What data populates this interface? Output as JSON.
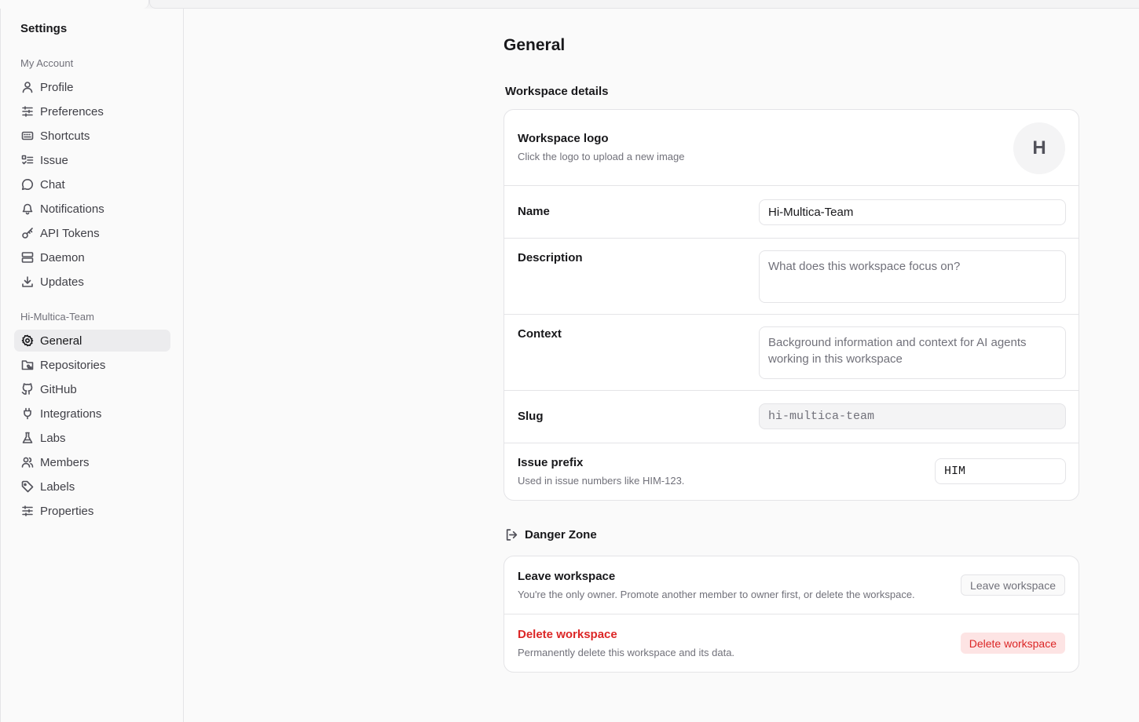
{
  "sidebar": {
    "title": "Settings",
    "account_section": "My Account",
    "account_items": [
      {
        "label": "Profile",
        "icon": "user-icon"
      },
      {
        "label": "Preferences",
        "icon": "sliders-icon"
      },
      {
        "label": "Shortcuts",
        "icon": "keyboard-icon"
      },
      {
        "label": "Issue",
        "icon": "list-check-icon"
      },
      {
        "label": "Chat",
        "icon": "chat-icon"
      },
      {
        "label": "Notifications",
        "icon": "bell-icon"
      },
      {
        "label": "API Tokens",
        "icon": "key-icon"
      },
      {
        "label": "Daemon",
        "icon": "server-icon"
      },
      {
        "label": "Updates",
        "icon": "download-icon"
      }
    ],
    "workspace_section": "Hi-Multica-Team",
    "workspace_items": [
      {
        "label": "General",
        "icon": "gear-icon",
        "active": true
      },
      {
        "label": "Repositories",
        "icon": "folder-git-icon"
      },
      {
        "label": "GitHub",
        "icon": "github-icon"
      },
      {
        "label": "Integrations",
        "icon": "plug-icon"
      },
      {
        "label": "Labs",
        "icon": "flask-icon"
      },
      {
        "label": "Members",
        "icon": "users-icon"
      },
      {
        "label": "Labels",
        "icon": "tag-icon"
      },
      {
        "label": "Properties",
        "icon": "sliders-icon"
      }
    ]
  },
  "main": {
    "title": "General",
    "details_title": "Workspace details",
    "logo": {
      "label": "Workspace logo",
      "hint": "Click the logo to upload a new image",
      "initial": "H"
    },
    "name": {
      "label": "Name",
      "value": "Hi-Multica-Team"
    },
    "description": {
      "label": "Description",
      "placeholder": "What does this workspace focus on?"
    },
    "context": {
      "label": "Context",
      "placeholder": "Background information and context for AI agents working in this workspace"
    },
    "slug": {
      "label": "Slug",
      "value": "hi-multica-team"
    },
    "issue_prefix": {
      "label": "Issue prefix",
      "hint": "Used in issue numbers like HIM-123.",
      "value": "HIM"
    },
    "danger": {
      "title": "Danger Zone",
      "leave": {
        "label": "Leave workspace",
        "hint": "You're the only owner. Promote another member to owner first, or delete the workspace.",
        "button": "Leave workspace"
      },
      "delete": {
        "label": "Delete workspace",
        "hint": "Permanently delete this workspace and its data.",
        "button": "Delete workspace"
      }
    }
  },
  "colors": {
    "danger": "#dc2626",
    "danger_bg": "#fde4e4",
    "active_bg": "#ececee"
  }
}
